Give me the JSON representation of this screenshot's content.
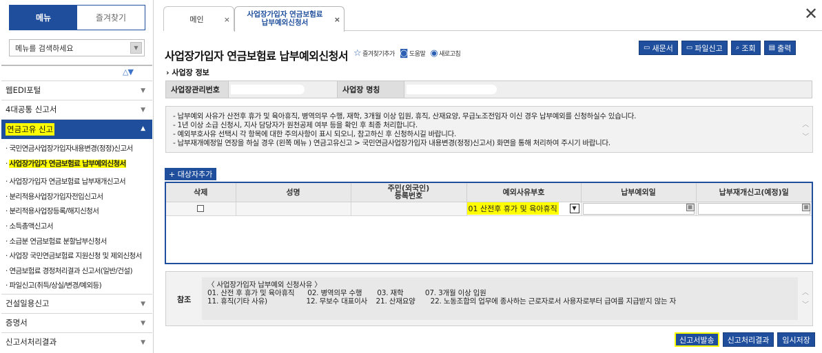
{
  "sidebar": {
    "tabs": [
      "메뉴",
      "즐겨찾기"
    ],
    "search_placeholder": "메뉴를 검색하세요",
    "groups": [
      {
        "label": "웹EDI포털"
      },
      {
        "label": "4대공통 신고서"
      },
      {
        "label": "연금고유 신고"
      },
      {
        "label": "건설일용신고"
      },
      {
        "label": "증명서"
      },
      {
        "label": "신고서처리결과"
      }
    ],
    "submenu": [
      "국민연금사업장가입자내용변경(정정)신고서",
      "사업장가입자 연금보험료 납부예외신청서",
      "사업장가입자 연금보험료 납부재개신고서",
      "분리적용사업장가입자전입신고서",
      "분리적용사업장등록/해지신청서",
      "소득총액신고서",
      "소급분 연금보험료 분할납부신청서",
      "사업장 국민연금보험료 지원신청 및 제외신청서",
      "연금보험료 경정처리결과 신고서(일반/건설)",
      "파일신고(취득/상실/변경/예외등)"
    ]
  },
  "tabs": {
    "main": "메인",
    "active_line1": "사업장가입자 연금보험료",
    "active_line2": "납부예외신청서"
  },
  "page": {
    "title": "사업장가입자 연금보험료 납부예외신청서",
    "links": [
      "즐겨찾기추가",
      "도움말",
      "새로고침"
    ],
    "top_buttons": [
      "새문서",
      "파일신고",
      "조회",
      "출력"
    ],
    "section_title": "사업장 정보",
    "info_labels": [
      "사업장관리번호",
      "사업장 명칭"
    ]
  },
  "notice": [
    "- 납부예외 사유가 산전후 휴가 및 육아휴직, 병역의무 수행, 재학, 3개월 이상 입원, 휴직, 산재요양, 무급노조전임자 이신 경우 납부예외를 신청하실수 있습니다.",
    "- 1년 이상 소급 신청시, 지사 담당자가 원천공제 여부 등을 확인 후 최종 처리합니다.",
    "- 예외부호사유 선택시 각 항목에 대한 주의사항이 표시 되오니, 참고하신 후 신청하시길 바랍니다.",
    "- 납부재개예정일 연장을 하실 경우 (왼쪽 메뉴 ) 연금고유신고 > 국민연금사업장가입자 내용변경(정정)신고서) 화면을 통해 처리하여 주시기 바랍니다."
  ],
  "grid": {
    "add_button": "+ 대상자추가",
    "headers": [
      "삭제",
      "성명",
      "주민(외국인)\n등록번호",
      "예외사유부호",
      "납부예외일",
      "납부재개신고(예정)일"
    ],
    "row": {
      "reason_value": "01 산전후 휴가 및 육아휴직"
    }
  },
  "reference": {
    "label": "참조",
    "lines": [
      "〈 사업장가입자 납부예외 신청사유 〉",
      "01. 산전 후 휴가 및 육아휴직      02. 병역의무 수행       03. 재학          07. 3개월 이상 입원",
      "11. 휴직(기타 사유)                  12. 무보수 대표이사    21. 산재요양       22. 노동조합의 업무에 종사하는 근로자로서 사용자로부터 급여를 지급받지 않는 자"
    ]
  },
  "bottom_buttons": [
    "신고서발송",
    "신고처리결과",
    "임시저장"
  ],
  "colors": {
    "primary": "#1e4e9c",
    "highlight": "#ffff00"
  }
}
